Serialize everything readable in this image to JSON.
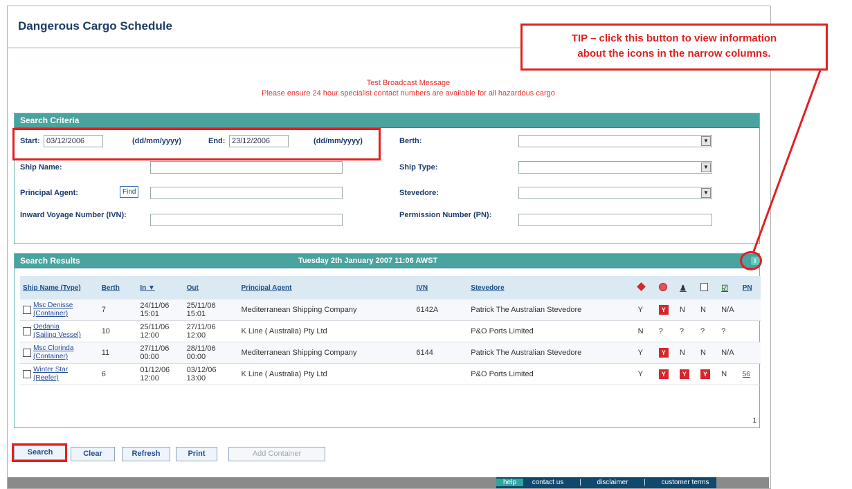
{
  "page": {
    "title": "Dangerous Cargo Schedule"
  },
  "broadcast": {
    "line1": "Test Broadcast Message",
    "line2": "Please ensure 24 hour specialist contact numbers are available for all hazardous cargo"
  },
  "criteria": {
    "heading": "Search Criteria",
    "start_label": "Start:",
    "start_value": "03/12/2006",
    "start_format": "(dd/mm/yyyy)",
    "end_label": "End:",
    "end_value": "23/12/2006",
    "end_format": "(dd/mm/yyyy)",
    "berth_label": "Berth:",
    "ship_name_label": "Ship Name:",
    "ship_type_label": "Ship Type:",
    "principal_agent_label": "Principal Agent:",
    "find_label": "Find",
    "stevedore_label": "Stevedore:",
    "ivn_label": "Inward Voyage Number (IVN):",
    "pn_label": "Permission Number (PN):"
  },
  "results": {
    "heading": "Search Results",
    "datetime": "Tuesday 2th January 2007 11:06 AWST",
    "info_icon": "i",
    "headers": {
      "ship": "Ship Name (Type)",
      "berth": "Berth",
      "in": "In ▼",
      "out": "Out",
      "agent": "Principal Agent",
      "ivn": "IVN",
      "stevedore": "Stevedore",
      "pn": "PN"
    },
    "rows": [
      {
        "ship": "Msc Denisse",
        "type": "(Container)",
        "berth": "7",
        "in_date": "24/11/06",
        "in_time": "15:01",
        "out_date": "25/11/06",
        "out_time": "15:01",
        "agent": "Mediterranean Shipping Company",
        "ivn": "6142A",
        "stevedore": "Patrick The Australian Stevedore",
        "c1": "Y",
        "c2": "Y",
        "c3": "N",
        "c4": "N",
        "c5": "N/A",
        "pn": ""
      },
      {
        "ship": "Oedania",
        "type": "(Sailing Vessel)",
        "berth": "10",
        "in_date": "25/11/06",
        "in_time": "12:00",
        "out_date": "27/11/06",
        "out_time": "12:00",
        "agent": "K Line ( Australia) Pty Ltd",
        "ivn": "",
        "stevedore": "P&O Ports Limited",
        "c1": "N",
        "c2": "?",
        "c3": "?",
        "c4": "?",
        "c5": "?",
        "pn": ""
      },
      {
        "ship": "Msc Clorinda",
        "type": "(Container)",
        "berth": "11",
        "in_date": "27/11/06",
        "in_time": "00:00",
        "out_date": "28/11/06",
        "out_time": "00:00",
        "agent": "Mediterranean Shipping Company",
        "ivn": "6144",
        "stevedore": "Patrick The Australian Stevedore",
        "c1": "Y",
        "c2": "Y",
        "c3": "N",
        "c4": "N",
        "c5": "N/A",
        "pn": ""
      },
      {
        "ship": "Winter Star",
        "type": "(Reefer)",
        "berth": "6",
        "in_date": "01/12/06",
        "in_time": "12:00",
        "out_date": "03/12/06",
        "out_time": "13:00",
        "agent": "K Line ( Australia) Pty Ltd",
        "ivn": "",
        "stevedore": "P&O Ports Limited",
        "c1": "Y",
        "c2": "Y",
        "c3": "Y",
        "c4": "Y",
        "c5": "N",
        "pn": "56"
      }
    ],
    "page_number": "1"
  },
  "buttons": {
    "search": "Search",
    "clear": "Clear",
    "refresh": "Refresh",
    "print": "Print",
    "add_container": "Add Container"
  },
  "footer": {
    "help": "help",
    "contact": "contact us",
    "disclaimer": "disclaimer",
    "terms": "customer terms",
    "separator": "|"
  },
  "callout": {
    "line1": "TIP – click this button to view information",
    "line2": "about the icons in the narrow columns."
  },
  "colors": {
    "header_teal": "#49a39e",
    "alert_red": "#e02020",
    "link_blue": "#2a4c9a"
  }
}
